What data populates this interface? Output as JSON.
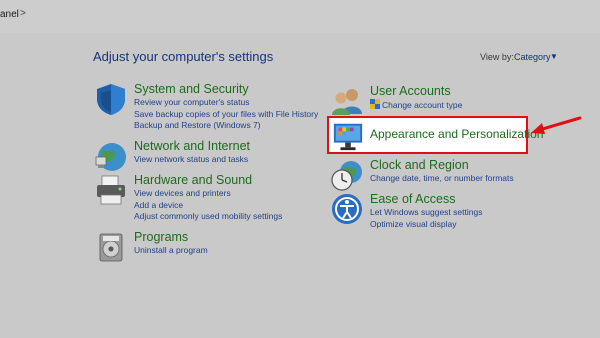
{
  "breadcrumb": {
    "text": "anel",
    "separator": ">"
  },
  "heading": "Adjust your computer's settings",
  "view_by": {
    "label": "View by:",
    "value": "Category",
    "caret": "▼"
  },
  "categories": {
    "system_security": {
      "title": "System and Security",
      "icon": "shield-icon",
      "links": [
        "Review your computer's status",
        "Save backup copies of your files with File History",
        "Backup and Restore (Windows 7)"
      ]
    },
    "network": {
      "title": "Network and Internet",
      "icon": "network-globe-icon",
      "links": [
        "View network status and tasks"
      ]
    },
    "hardware": {
      "title": "Hardware and Sound",
      "icon": "printer-icon",
      "links": [
        "View devices and printers",
        "Add a device",
        "Adjust commonly used mobility settings"
      ]
    },
    "programs": {
      "title": "Programs",
      "icon": "programs-disk-icon",
      "links": [
        "Uninstall a program"
      ]
    },
    "user_accounts": {
      "title": "User Accounts",
      "icon": "users-icon",
      "links": [
        "Change account type"
      ]
    },
    "appearance": {
      "title": "Appearance and Personalization",
      "icon": "monitor-palette-icon",
      "links": []
    },
    "clock": {
      "title": "Clock and Region",
      "icon": "clock-globe-icon",
      "links": [
        "Change date, time, or number formats"
      ]
    },
    "ease": {
      "title": "Ease of Access",
      "icon": "ease-of-access-icon",
      "links": [
        "Let Windows suggest settings",
        "Optimize visual display"
      ]
    }
  },
  "colors": {
    "overlay_bg": "#c9c9c9",
    "title_green": "#1d6b1d",
    "link_blue": "#22418c",
    "highlight_border": "#e01010",
    "arrow": "#e01010"
  }
}
